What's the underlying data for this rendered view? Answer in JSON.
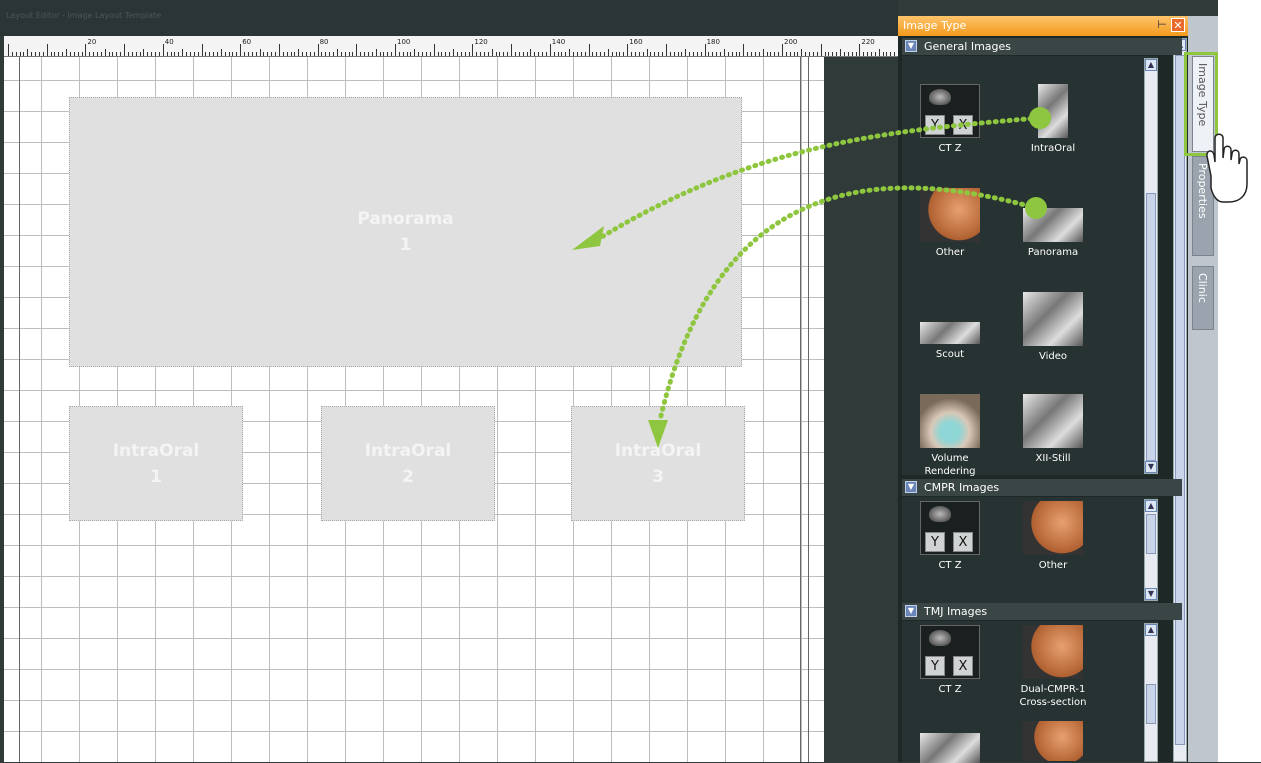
{
  "titlebar": {
    "text": "Layout Editor - Image Layout Template"
  },
  "ruler": {
    "labels": [
      "20",
      "40",
      "60",
      "80",
      "100",
      "120",
      "140",
      "160",
      "180",
      "200",
      "220"
    ]
  },
  "canvas": {
    "slots": [
      {
        "name": "slot-panorama-1",
        "label": "Panorama\n1"
      },
      {
        "name": "slot-intraoral-1",
        "label": "IntraOral\n1"
      },
      {
        "name": "slot-intraoral-2",
        "label": "IntraOral\n2"
      },
      {
        "name": "slot-intraoral-3",
        "label": "IntraOral\n3"
      }
    ]
  },
  "panel": {
    "title": "Image Type",
    "sections": [
      {
        "title": "General Images",
        "items": [
          "CT Z",
          "IntraOral",
          "Other",
          "Panorama",
          "Scout",
          "Video",
          "Volume Rendering",
          "XII-Still"
        ]
      },
      {
        "title": "CMPR Images",
        "items": [
          "CT Z",
          "Other"
        ]
      },
      {
        "title": "TMJ Images",
        "items": [
          "CT Z",
          "Dual-CMPR-1\nCross-section"
        ]
      }
    ],
    "ctz_buttons": {
      "y": "Y",
      "x": "X"
    }
  },
  "side_tabs": [
    "Image Type",
    "Properties",
    "Clinic"
  ],
  "colors": {
    "accent": "#8fc63f",
    "panel_title": "#f29a1c"
  }
}
